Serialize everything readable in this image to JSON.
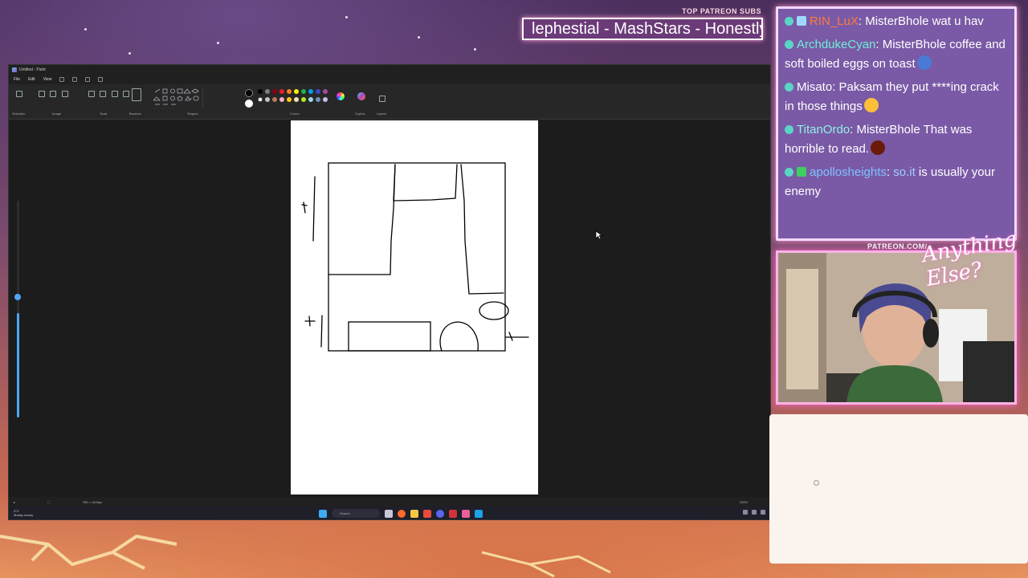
{
  "ticker": {
    "heading": "TOP PATREON SUBS",
    "text": "lephestial - MashStars - Honestly"
  },
  "paint": {
    "window_title": "Untitled - Paint",
    "menu": [
      "File",
      "Edit",
      "View"
    ],
    "ribbon_labels": [
      "Selection",
      "Image",
      "Tools",
      "Brushes",
      "Shapes",
      "Colors",
      "Copilot",
      "Layers"
    ],
    "canvas_size": "780 × 1420px",
    "zoom": "100%",
    "palette": [
      "#000000",
      "#7f7f7f",
      "#880015",
      "#ed1c24",
      "#ff7f27",
      "#fff200",
      "#22b14c",
      "#00a2e8",
      "#3f48cc",
      "#a349a4",
      "#ffffff",
      "#c3c3c3",
      "#b97a57",
      "#ffaec9",
      "#ffc90e",
      "#efe4b0",
      "#b5e61d",
      "#99d9ea",
      "#7092be",
      "#c8bfe7"
    ]
  },
  "taskbar": {
    "weather_temp": "4°C",
    "weather_desc": "Mostly cloudy",
    "search_placeholder": "Search"
  },
  "chat": {
    "messages": [
      {
        "user": "RIN_LuX",
        "user_color": "#ff7a3c",
        "text": "MisterBhole wat u hav",
        "badge_color": "#9fd8ff"
      },
      {
        "user": "ArchdukeCyan",
        "user_color": "#6ef0d8",
        "text": "MisterBhole coffee and soft boiled eggs on toast",
        "emote_color": "#4a7ad6"
      },
      {
        "user": "Misato",
        "user_color": "#ffffff",
        "text": "Paksam they put ****ing crack in those things",
        "emote_color": "#ffbe3a"
      },
      {
        "user": "TitanOrdo",
        "user_color": "#8ff0e8",
        "text": "MisterBhole That was horrible to read.",
        "emote_color": "#6b1a0a"
      },
      {
        "user": "apollosheights",
        "user_color": "#7fc3ff",
        "text": "so.it is usually your enemy",
        "link": "so.it",
        "badge_color": "#3fcf5e"
      }
    ]
  },
  "webcam": {
    "patreon_label": "PATREON.COM/",
    "logo_text": "Anything Else?"
  }
}
